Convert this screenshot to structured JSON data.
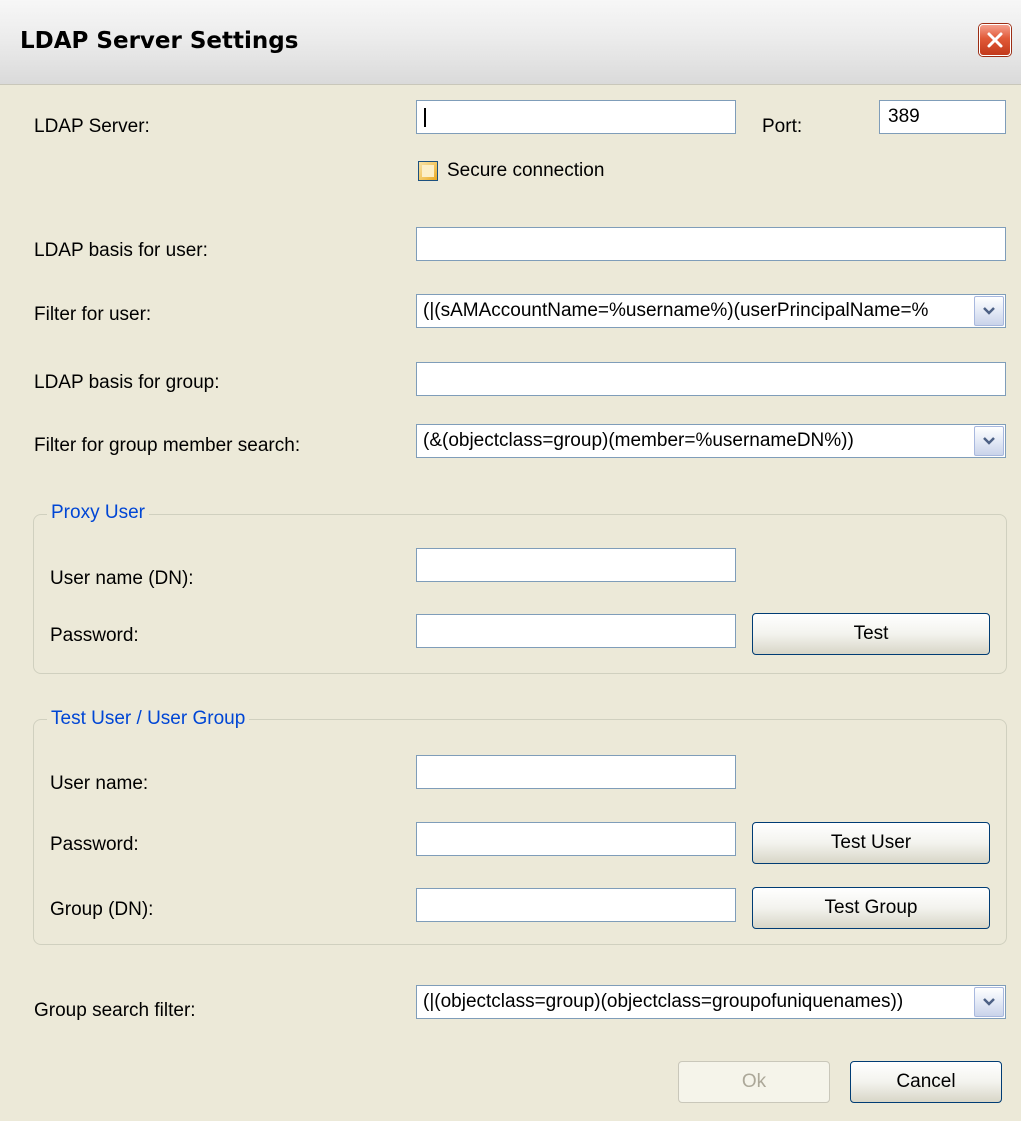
{
  "window": {
    "title": "LDAP Server Settings",
    "close_icon": "close-icon"
  },
  "server": {
    "label": "LDAP Server:",
    "value": "",
    "port_label": "Port:",
    "port_value": "389",
    "secure_label": "Secure connection",
    "secure_checked": false
  },
  "user": {
    "basis_label": "LDAP basis for user:",
    "basis_value": "",
    "filter_label": "Filter for user:",
    "filter_value": "(|(sAMAccountName=%username%)(userPrincipalName=%"
  },
  "group": {
    "basis_label": "LDAP basis for group:",
    "basis_value": "",
    "member_filter_label": "Filter for group member search:",
    "member_filter_value": "(&(objectclass=group)(member=%usernameDN%))"
  },
  "proxy_user": {
    "legend": "Proxy User",
    "username_label": "User name (DN):",
    "username_value": "",
    "password_label": "Password:",
    "password_value": "",
    "test_button": "Test"
  },
  "test_user_group": {
    "legend": "Test User / User Group",
    "username_label": "User name:",
    "username_value": "",
    "password_label": "Password:",
    "password_value": "",
    "test_user_button": "Test User",
    "group_label": "Group (DN):",
    "group_value": "",
    "test_group_button": "Test Group"
  },
  "group_search": {
    "label": "Group search filter:",
    "value": "(|(objectclass=group)(objectclass=groupofuniquenames))"
  },
  "footer": {
    "ok_button": "Ok",
    "cancel_button": "Cancel"
  },
  "colors": {
    "dialog_bg": "#ece9d8",
    "legend_text": "#0046d5",
    "close_button": "#e15a38",
    "input_border": "#7f9db9"
  }
}
